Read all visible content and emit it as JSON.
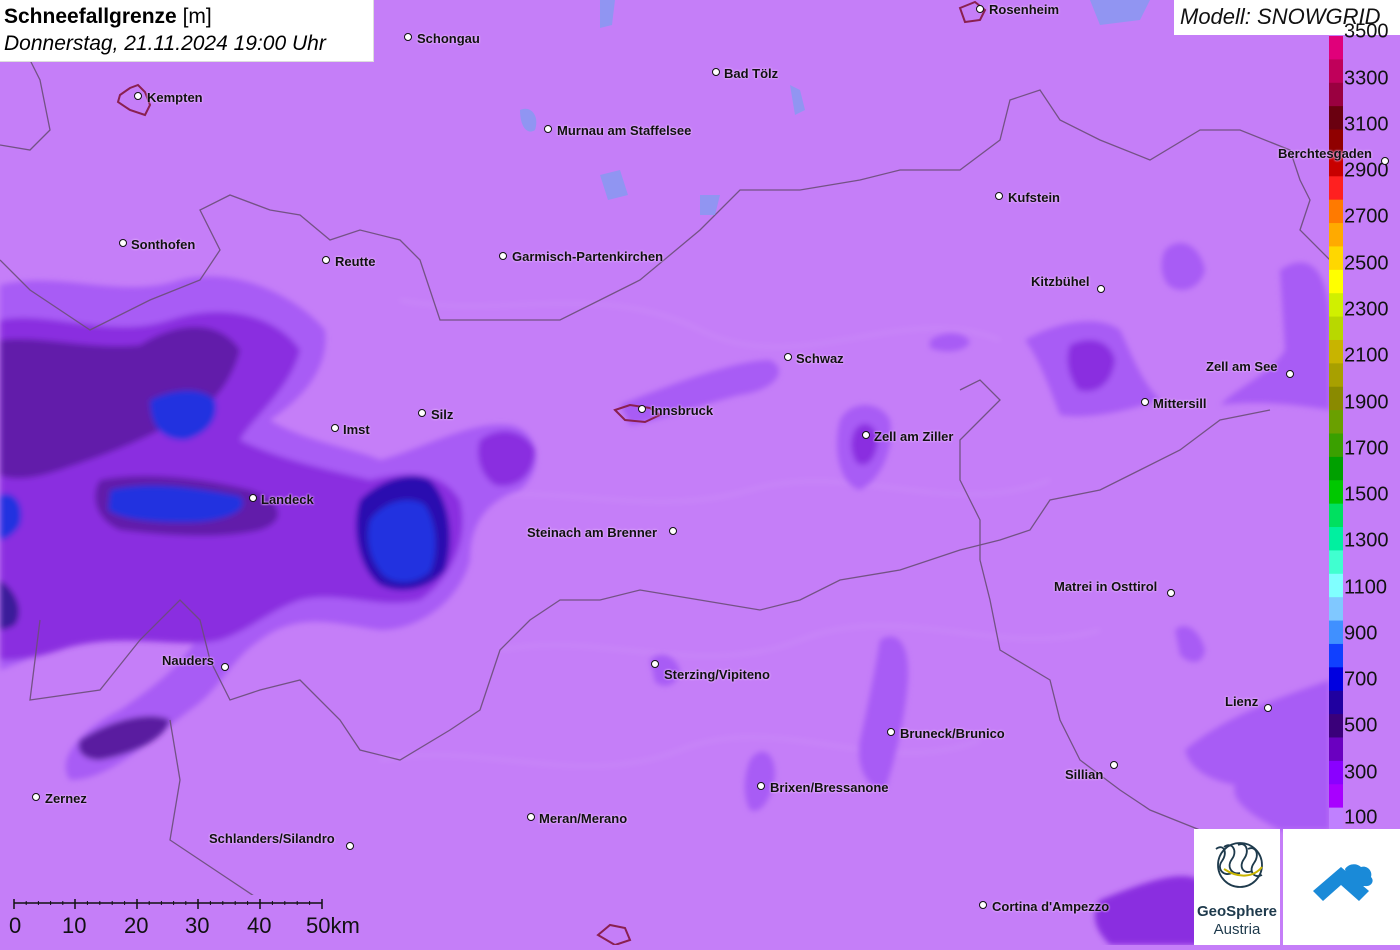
{
  "header": {
    "title_bold": "Schneefallgrenze",
    "title_unit": "[m]",
    "subtitle": "Donnerstag, 21.11.2024 19:00 Uhr"
  },
  "model": {
    "label": "Modell: SNOWGRID"
  },
  "legend": {
    "ticks": [
      "3500",
      "3300",
      "3100",
      "2900",
      "2700",
      "2500",
      "2300",
      "2100",
      "1900",
      "1700",
      "1500",
      "1300",
      "1100",
      "900",
      "700",
      "500",
      "300",
      "100"
    ],
    "colors": [
      "#e0007a",
      "#c0005a",
      "#9a0040",
      "#6a0010",
      "#900000",
      "#c80000",
      "#ff2020",
      "#ff7a00",
      "#ffaa00",
      "#ffd700",
      "#ffff00",
      "#d0f000",
      "#b8d800",
      "#c8b400",
      "#a8a000",
      "#8a8a00",
      "#6aa000",
      "#3aa000",
      "#00a000",
      "#00c800",
      "#00e060",
      "#00f0a0",
      "#40ffd0",
      "#80ffff",
      "#80c8ff",
      "#4090ff",
      "#1040ff",
      "#0000e0",
      "#2000a0",
      "#3a007a",
      "#6a00c0",
      "#8a00ff",
      "#a800ff",
      "#c080ff"
    ]
  },
  "cities": [
    {
      "name": "Rosenheim"
    },
    {
      "name": "Schongau"
    },
    {
      "name": "Kempten"
    },
    {
      "name": "Bad Tölz"
    },
    {
      "name": "Murnau am Staffelsee"
    },
    {
      "name": "Berchtesgaden"
    },
    {
      "name": "Kufstein"
    },
    {
      "name": "Sonthofen"
    },
    {
      "name": "Reutte"
    },
    {
      "name": "Garmisch-Partenkirchen"
    },
    {
      "name": "Kitzbühel"
    },
    {
      "name": "Schwaz"
    },
    {
      "name": "Zell am See"
    },
    {
      "name": "Mittersill"
    },
    {
      "name": "Imst"
    },
    {
      "name": "Silz"
    },
    {
      "name": "Innsbruck"
    },
    {
      "name": "Zell am Ziller"
    },
    {
      "name": "Landeck"
    },
    {
      "name": "Steinach am Brenner"
    },
    {
      "name": "Matrei in Osttirol"
    },
    {
      "name": "Nauders"
    },
    {
      "name": "Sterzing/Vipiteno"
    },
    {
      "name": "Lienz"
    },
    {
      "name": "Bruneck/Brunico"
    },
    {
      "name": "Sillian"
    },
    {
      "name": "Brixen/Bressanone"
    },
    {
      "name": "Zernez"
    },
    {
      "name": "Meran/Merano"
    },
    {
      "name": "Schlanders/Silandro"
    },
    {
      "name": "Cortina d'Ampezzo"
    }
  ],
  "scale": {
    "labels": [
      "0",
      "10",
      "20",
      "30",
      "40",
      "50km"
    ]
  },
  "logos": {
    "geosphere_line1": "GeoSphere",
    "geosphere_line2": "Austria"
  }
}
